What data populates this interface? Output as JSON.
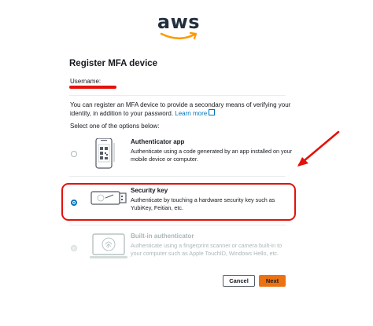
{
  "logo": {
    "text": "aws"
  },
  "page": {
    "title": "Register MFA device",
    "username_label": "Username:",
    "intro_text": "You can register an MFA device to provide a secondary means of verifying your identity, in addition to your password.",
    "learn_more": "Learn more",
    "select_label": "Select one of the options below:"
  },
  "options": [
    {
      "title": "Authenticator app",
      "description": "Authenticate using a code generated by an app installed on your mobile device or computer.",
      "selected": false,
      "disabled": false,
      "icon": "phone-qr-icon"
    },
    {
      "title": "Security key",
      "description": "Authenticate by touching a hardware security key such as YubiKey, Feitian, etc.",
      "selected": true,
      "disabled": false,
      "icon": "usb-key-icon"
    },
    {
      "title": "Built-in authenticator",
      "description": "Authenticate using a fingerprint scanner or camera built-in to your computer such as Apple TouchID, Windows Hello, etc.",
      "selected": false,
      "disabled": true,
      "icon": "laptop-fingerprint-icon"
    }
  ],
  "buttons": {
    "cancel": "Cancel",
    "next": "Next"
  },
  "colors": {
    "accent": "#ec7211",
    "link": "#0073bb",
    "annotation": "#e3120b",
    "logo_smile": "#ff9900"
  }
}
